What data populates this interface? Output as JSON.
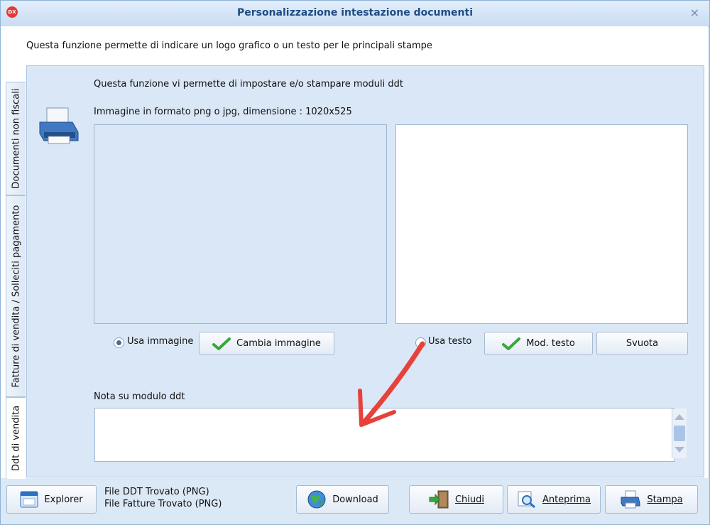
{
  "window": {
    "title": "Personalizzazione intestazione documenti",
    "app_icon_text": "DX",
    "close_label": "✕"
  },
  "header": {
    "description": "Questa funzione permette di indicare un logo grafico o un testo per le principali stampe"
  },
  "tabs": [
    {
      "label": "Documenti non fiscali"
    },
    {
      "label": "Fatture di vendita / Solleciti pagamento"
    },
    {
      "label": "Ddt di vendita"
    }
  ],
  "panel": {
    "intro": "Questa funzione vi permette di impostare e/o stampare moduli ddt",
    "image_hint": "Immagine in formato png o jpg, dimensione : 1020x525",
    "use_image_label": "Usa immagine",
    "change_image_label": "Cambia immagine",
    "use_text_label": "Usa testo",
    "edit_text_label": "Mod. testo",
    "clear_label": "Svuota",
    "note_label": "Nota su modulo ddt",
    "note_value": "",
    "selected_mode": "Usa immagine"
  },
  "footer": {
    "explorer_label": "Explorer",
    "status_line_1": "File DDT Trovato (PNG)",
    "status_line_2": "File Fatture Trovato (PNG)",
    "download_label": "Download",
    "close_label": "Chiudi",
    "preview_label": "Anteprima",
    "print_label": "Stampa"
  },
  "colors": {
    "accent": "#1f4c82",
    "panel": "#dae7f6",
    "arrow": "#e8413a",
    "check": "#3aa63a"
  }
}
